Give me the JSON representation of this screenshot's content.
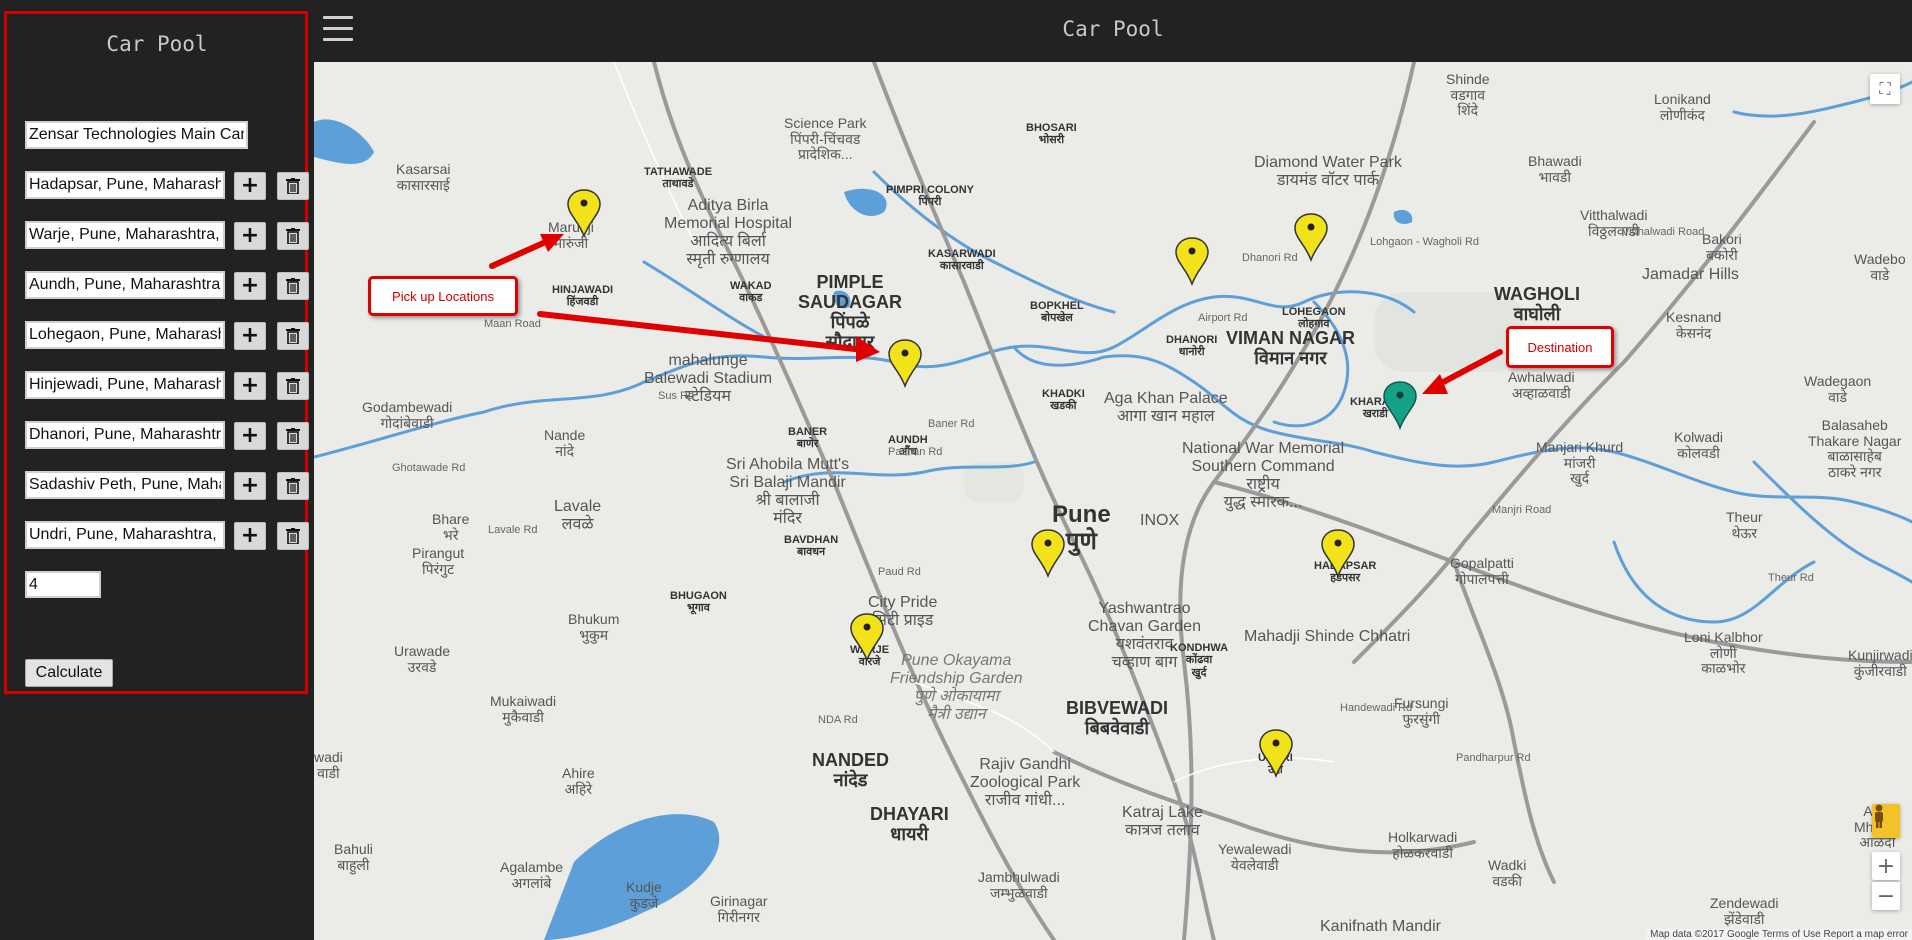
{
  "app": {
    "title": "Car Pool",
    "sidebar_title": "Car Pool"
  },
  "form": {
    "destination": "Zensar Technologies Main Campus",
    "locations": [
      "Hadapsar, Pune, Maharashtra, India",
      "Warje, Pune, Maharashtra, India",
      "Aundh, Pune, Maharashtra, India",
      "Lohegaon, Pune, Maharashtra, India",
      "Hinjewadi, Pune, Maharashtra, India",
      "Dhanori, Pune, Maharashtra, India",
      "Sadashiv Peth, Pune, Maharashtra, India",
      "Undri, Pune, Maharashtra, India"
    ],
    "add_glyph": "+",
    "delete_icon": "trash-icon",
    "count": "4",
    "calculate_label": "Calculate"
  },
  "annotations": {
    "pickup": "Pick up Locations",
    "destination": "Destination"
  },
  "map": {
    "labels": {
      "kasarsai": "Kasarsai\nकासारसाई",
      "marunji": "Marunji\nमारुंजी",
      "hinjawadi": "HINJAWADI\nहिंजवडी",
      "tathawade": "TATHAWADE\nताथावडे",
      "aditya": "Aditya Birla\nMemorial Hospital\nआदित्य बिर्ला\nस्मृती रुग्णालय",
      "pimpri_colony": "PIMPRI COLONY\nपिंपरी",
      "kasarwadi": "KASARWADI\nकासारवाडी",
      "bhosari": "BHOSARI\nभोसरी",
      "science_park": "Science Park\nपिंपरी-चिंचवड\nप्रादेशिक...",
      "wakad": "WAKAD\nवाकड",
      "pimple_saudagar": "PIMPLE\nSAUDAGAR\nपिंपळे\nसौदागर",
      "bopkhel": "BOPKHEL\nबोपखेल",
      "mahalunge": "mahalunge\nBalewadi Stadium\nस्टेडियम",
      "godambewadi": "Godambewadi\nगोदांबेवाडी",
      "nande": "Nande\nनांदे",
      "baner": "BANER\nबाणेर",
      "aundh": "AUNDH\nऔंध",
      "khadki": "KHADKI\nखडकी",
      "dhanori": "DHANORI\nधानोरी",
      "lohegaon": "LOHEGAON\nलोहगाव",
      "viman_nagar": "VIMAN NAGAR\nविमान नगर",
      "aga_khan": "Aga Khan Palace\nआगा खान महाल",
      "war_memorial": "National War Memorial\nSouthern Command\nराष्ट्रीय\nयुद्ध स्मारक...",
      "kharadi": "KHARADI\nखराडी",
      "wagholi": "WAGHOLI\nवाघोली",
      "shinde_wadgaon": "Shinde\nवडगाव\nशिंदे",
      "diamond_park": "Diamond Water Park\nडायमंड वॉटर पार्क",
      "bhawadi": "Bhawadi\nभावडी",
      "lonikand": "Lonikand\nलोणीकंद",
      "vitthalwadi": "Vitthalwadi\nविठ्ठलवाडी",
      "bakori": "Bakori\nबकोरी",
      "jamadar": "Jamadar Hills",
      "kesnand": "Kesnand\nकेसनंद",
      "wadebolhai": "Wadebo\nवाडे",
      "awhalwadi": "Awhalwadi\nअव्हाळवाडी",
      "wadegaon": "Wadegaon\nवाडे",
      "kolwadi": "Kolwadi\nकोलवडी",
      "balasaheb": "Balasaheb\nThakare Nagar\nबाळासाहेब\nठाकरे नगर",
      "manjari": "Manjari Khurd\nमांजरी\nखुर्द",
      "theur": "Theur\nथेऊर",
      "sri_ahobila": "Sri Ahobila Mutt's\nSri Balaji Mandir\nश्री बालाजी\nमंदिर",
      "pune": "Pune\nपुणे",
      "inox": "INOX",
      "lavale": "Lavale\nलवळे",
      "bhare": "Bhare\nभरे",
      "pirangut": "Pirangut\nपिरंगुट",
      "bavdhan": "BAVDHAN\nबावधन",
      "hadapsar": "HADAPSAR\nहडपसर",
      "gopalpatti": "Gopalpatti\nगोपालपत्ती",
      "bhugaon": "BHUGAON\nभूगाव",
      "city_pride": "City Pride\nसिटी प्राइड",
      "yashwantrao": "Yashwantrao\nChavan Garden\nयशवंतराव\nचव्हाण बाग",
      "mahadji": "Mahadji Shinde Chhatri",
      "loni_kalbhor": "Loni Kalbhor\nलोणी\nकाळभोर",
      "kunjirwadi": "Kunjirwadi\nकुंजीरवाडी",
      "bhukum": "Bhukum\nभुकुम",
      "urawade": "Urawade\nउरवडे",
      "warje": "WARJE\nवारजे",
      "okayama": "Pune Okayama\nFriendship Garden\nपुणे ओकायामा\nमैत्री उद्यान",
      "kondhwa": "KONDHWA\nकोंढवा\nखुर्द",
      "fursungi": "Fursungi\nफुरसुंगी",
      "mukaiwadi": "Mukaiwadi\nमुकैवाडी",
      "bibvewadi": "BIBVEWADI\nबिबवेवाडी",
      "undri": "UNDRI\nउंद्री",
      "nanded": "NANDED\nनांदेड",
      "ahire": "Ahire\nअहिरे",
      "rajiv_gandhi": "Rajiv Gandhi\nZoological Park\nराजीव गांधी...",
      "dhayari": "DHAYARI\nधायरी",
      "katraj": "Katraj Lake\nकात्रज तलाव",
      "yewalewadi": "Yewalewadi\nयेवलेवाडी",
      "holkarwadi": "Holkarwadi\nहोळकरवाडी",
      "wadki": "Wadki\nवडकी",
      "bahuli": "Bahuli\nबाहुली",
      "agalambe": "Agalambe\nअगलांबे",
      "kudje": "Kudje\nकुडजे",
      "girinagar": "Girinagar\nगिरीनगर",
      "jambhulwadi": "Jambhulwadi\nजम्भुळवाडी",
      "kanifnath": "Kanifnath Mandir",
      "zendewadi": "Zendewadi\nझेंडेवाडी",
      "ahmatpur": "Alha\nMhatob\nआळंदी",
      "wadi_left": "wadi\nवाडी",
      "sus_rd": "Sus Rd",
      "baner_rd": "Baner Rd",
      "pashan_rd": "Pashan Rd",
      "paud_rd": "Paud Rd",
      "nda_rd": "NDA Rd",
      "airport_rd": "Airport Rd",
      "lohgaon_rd": "Lohgaon - Wagholi Rd",
      "manjri_rd": "Manjri Road",
      "maan_road": "Maan Road",
      "ghotawade": "Ghotawade Rd",
      "lavale_rd": "Lavale Rd",
      "handewadi": "Handewadi Rd",
      "pandharpur": "Pandharpur Rd",
      "theur_rd": "Theur Rd",
      "vitthalwadi_rd": "Vitthalwadi Road",
      "dhanori_rd": "Dhanori Rd"
    },
    "footer": "Map data ©2017 Google   Terms of Use   Report a map error"
  },
  "colors": {
    "frame": "#d40000",
    "pickup_pin": "#f2e21a",
    "destination_pin": "#16a085",
    "water": "#5d9fd8",
    "road": "#9a9a9a"
  }
}
